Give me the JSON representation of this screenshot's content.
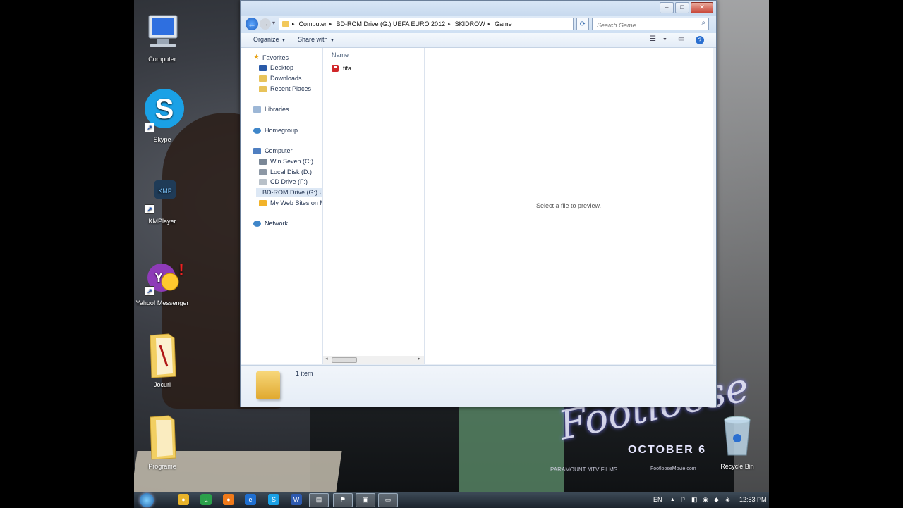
{
  "desktop": {
    "icons": [
      {
        "label": "Computer"
      },
      {
        "label": "Skype"
      },
      {
        "label": "KMPlayer"
      },
      {
        "label": "Yahoo! Messenger"
      },
      {
        "label": "Jocuri"
      },
      {
        "label": "Programe"
      },
      {
        "label": "Recycle Bin"
      }
    ],
    "wallpaper": {
      "title": "Footloose",
      "date": "OCTOBER 6",
      "small": "FootlooseMovie.com",
      "logos": "PARAMOUNT  MTV FILMS"
    }
  },
  "explorer": {
    "breadcrumbs": [
      "Computer",
      "BD-ROM Drive (G:) UEFA EURO 2012",
      "SKIDROW",
      "Game"
    ],
    "search_placeholder": "Search Game",
    "toolbar": {
      "organize": "Organize",
      "share": "Share with"
    },
    "nav": {
      "favorites": "Favorites",
      "favorites_items": [
        "Desktop",
        "Downloads",
        "Recent Places"
      ],
      "libraries": "Libraries",
      "homegroup": "Homegroup",
      "computer": "Computer",
      "computer_items": [
        "Win Seven (C:)",
        "Local Disk (D:)",
        "CD Drive (F:)",
        "BD-ROM Drive (G:) U",
        "My Web Sites on MS"
      ],
      "network": "Network"
    },
    "file_list": {
      "column_name": "Name",
      "files": [
        {
          "name": "fifa"
        }
      ]
    },
    "preview_message": "Select a file to preview.",
    "details": {
      "item_count": "1 item"
    }
  },
  "taskbar": {
    "language": "EN",
    "time": "12:53 PM"
  }
}
